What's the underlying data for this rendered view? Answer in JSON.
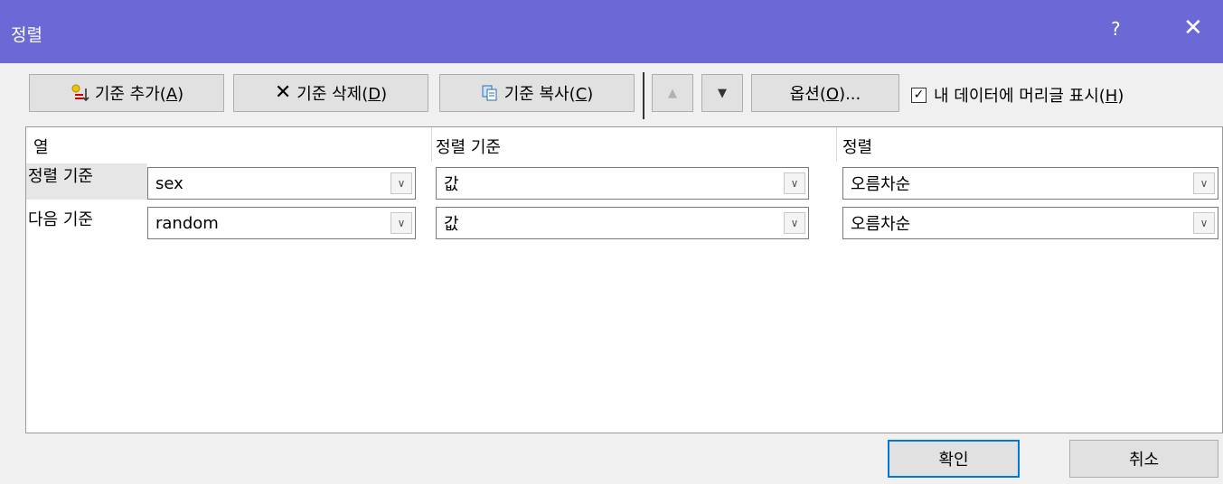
{
  "titlebar": {
    "title": "정렬",
    "help": "?",
    "close": "✕"
  },
  "toolbar": {
    "add": {
      "text": "기준 추가(",
      "key": "A",
      "end": ")"
    },
    "delete": {
      "text": "기준 삭제(",
      "key": "D",
      "end": ")"
    },
    "copy": {
      "text": "기준 복사(",
      "key": "C",
      "end": ")"
    },
    "up": "▲",
    "down": "▼",
    "options": {
      "text": "옵션(",
      "key": "O",
      "end": ")..."
    },
    "header_checkbox": {
      "checked": true,
      "mark": "✓",
      "text": "내 데이터에 머리글 표시(",
      "key": "H",
      "end": ")"
    }
  },
  "grid": {
    "headers": {
      "column": "열",
      "sort_on": "정렬 기준",
      "order": "정렬"
    },
    "rows": [
      {
        "label": "정렬 기준",
        "column": "sex",
        "sort_on": "값",
        "order": "오름차순"
      },
      {
        "label": "다음 기준",
        "column": "random",
        "sort_on": "값",
        "order": "오름차순"
      }
    ],
    "arrow": "∨"
  },
  "footer": {
    "ok": "확인",
    "cancel": "취소"
  }
}
